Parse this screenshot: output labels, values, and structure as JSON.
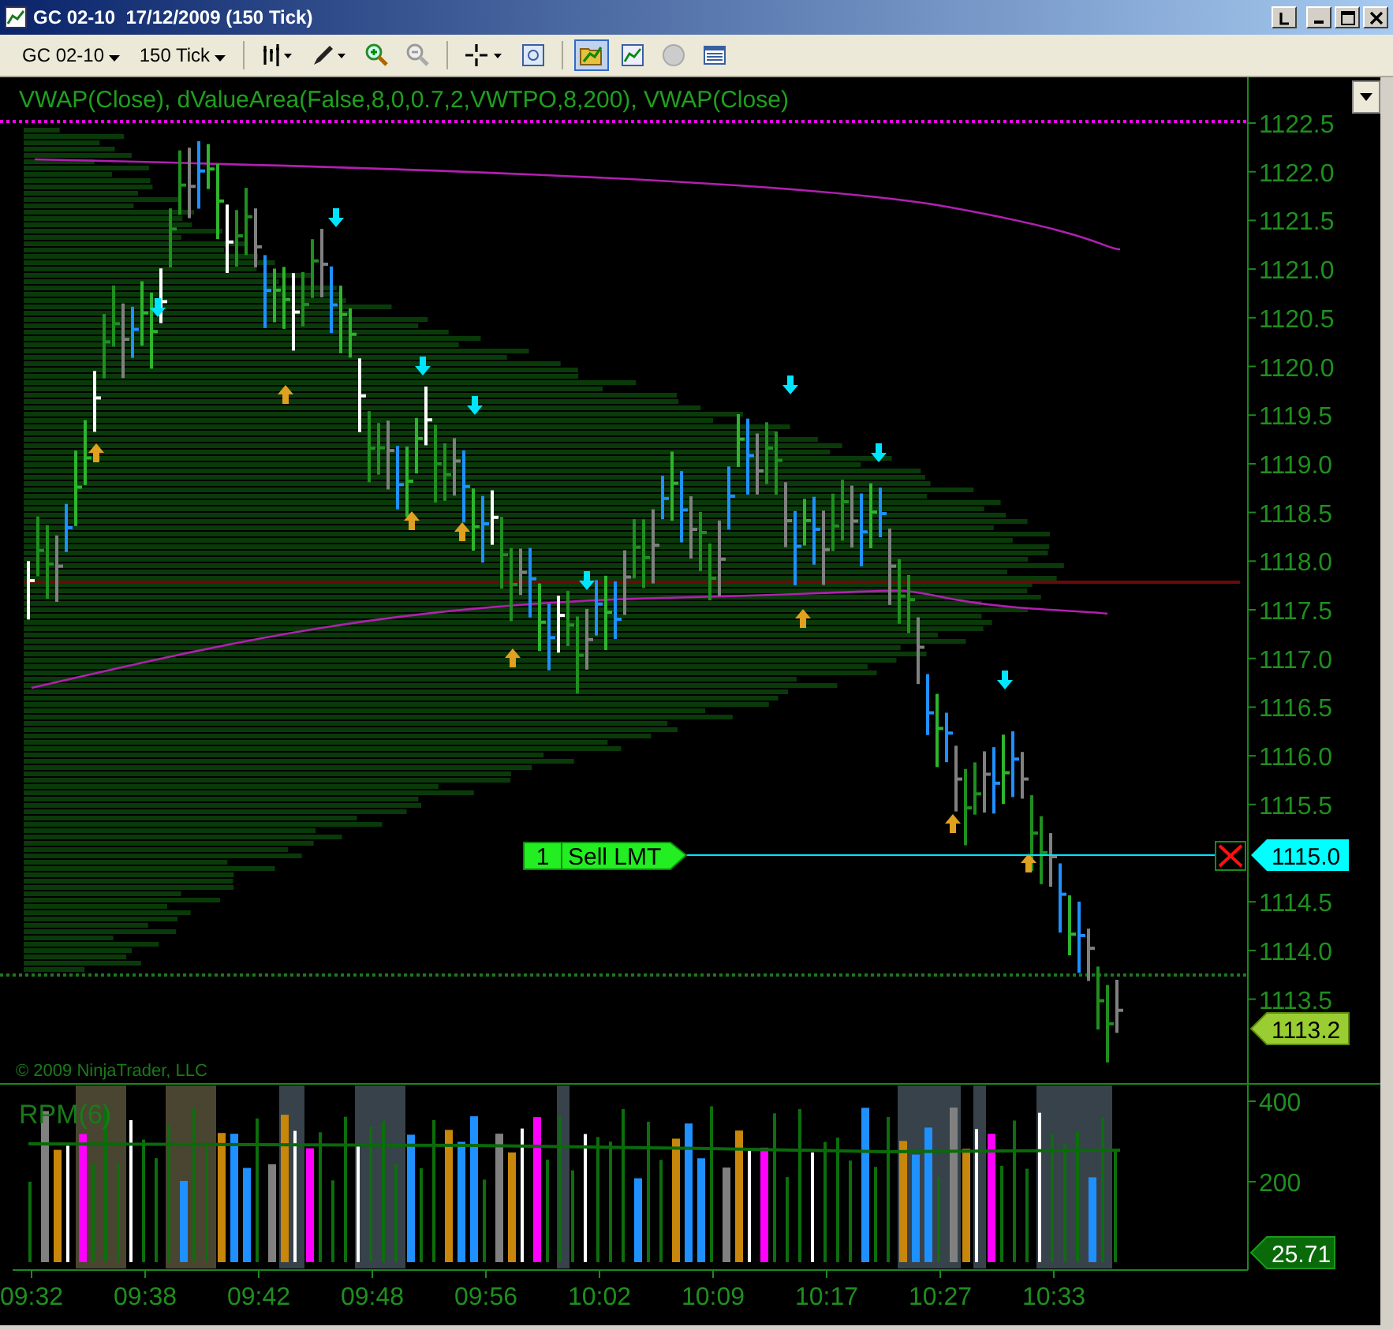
{
  "window": {
    "title": "GC 02-10  17/12/2009 (150 Tick)"
  },
  "toolbar": {
    "instrument": "GC 02-10",
    "interval": "150 Tick"
  },
  "price_panel": {
    "indicator_label": "VWAP(Close), dValueArea(False,8,0,0.7,2,VWTPO,8,200), VWAP(Close)",
    "price_labels": [
      "1122.5",
      "1122.0",
      "1121.5",
      "1121.0",
      "1120.5",
      "1120.0",
      "1119.5",
      "1119.0",
      "1118.5",
      "1118.0",
      "1117.5",
      "1117.0",
      "1116.5",
      "1116.0",
      "1115.5",
      "1114.5",
      "1114.0",
      "1113.5"
    ],
    "order": {
      "quantity": "1",
      "label": "Sell LMT",
      "price": "1115.0"
    },
    "last_price": "1113.2",
    "copyright": "© 2009 NinjaTrader, LLC"
  },
  "rpm_panel": {
    "label": "RPM(6)",
    "axis_labels": [
      "400",
      "200"
    ],
    "last_value": "25.71"
  },
  "time_labels": [
    "09:32",
    "09:38",
    "09:42",
    "09:48",
    "09:56",
    "10:02",
    "10:09",
    "10:17",
    "10:27",
    "10:33"
  ]
}
